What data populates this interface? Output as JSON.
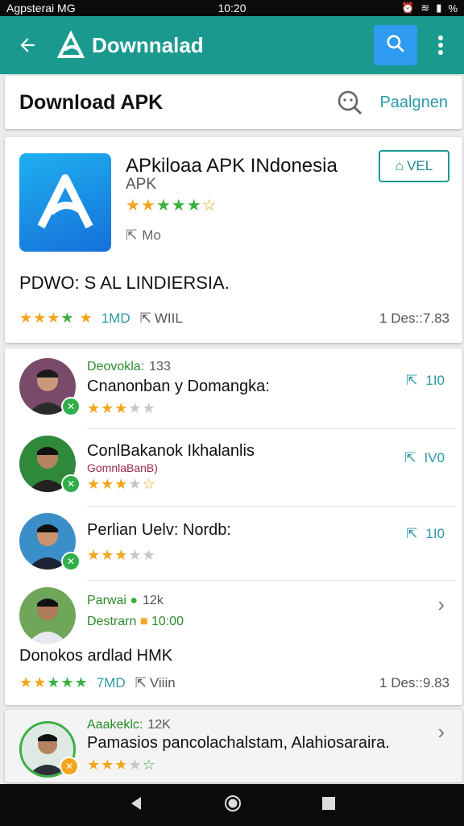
{
  "status_bar": {
    "left": "Agpsterai MG",
    "time": "10:20",
    "right": "% "
  },
  "app_bar": {
    "title": "Downnalad"
  },
  "header_card": {
    "title": "Download APK",
    "link": "Paalgnen"
  },
  "app_card": {
    "name": "APkiloaa APK INdonesia",
    "subtitle": "APK",
    "share_label": "Mo",
    "tag_label": "VEL",
    "description": "PDWO: S  AL LINDIERSIA.",
    "count": "1MD",
    "share_text": "WIIL",
    "right_text": "1  Des::7.83"
  },
  "list": [
    {
      "meta": "Deovokla:",
      "meta_num": "133",
      "title": "Cnanonban y Domangka:",
      "action": "1I0"
    },
    {
      "title": "ConlBakanok Ikhalanlis",
      "subtitle": "GomnlaBanB)",
      "action": "IV0"
    },
    {
      "title": "Perlian Uelv: Nordb:",
      "action": "1I0"
    },
    {
      "meta": "Parwai",
      "meta_num": "12k",
      "meta2": "Destrarn",
      "meta2_num": "10:00",
      "title": "Donokos ardlad  HMK",
      "count": "7MD",
      "share_text": "Viiin",
      "right_text": "1  Des::9.83"
    }
  ],
  "peek_item": {
    "meta": "Aaakeklc:",
    "meta_num": "12K",
    "title": "Pamasios pancolachalstam, Alahiosaraira."
  },
  "colors": {
    "primary": "#1a9a8f",
    "search_button": "#2f9bf0",
    "accent_text": "#2a9aa8",
    "star": "#f3a51b",
    "star_green": "#3cb043"
  },
  "icons": [
    "back-arrow-icon",
    "app-logo-icon",
    "search-icon",
    "more-vert-icon",
    "magnifier-icon",
    "share-icon",
    "nav-back-icon",
    "nav-home-icon",
    "nav-recent-icon"
  ]
}
